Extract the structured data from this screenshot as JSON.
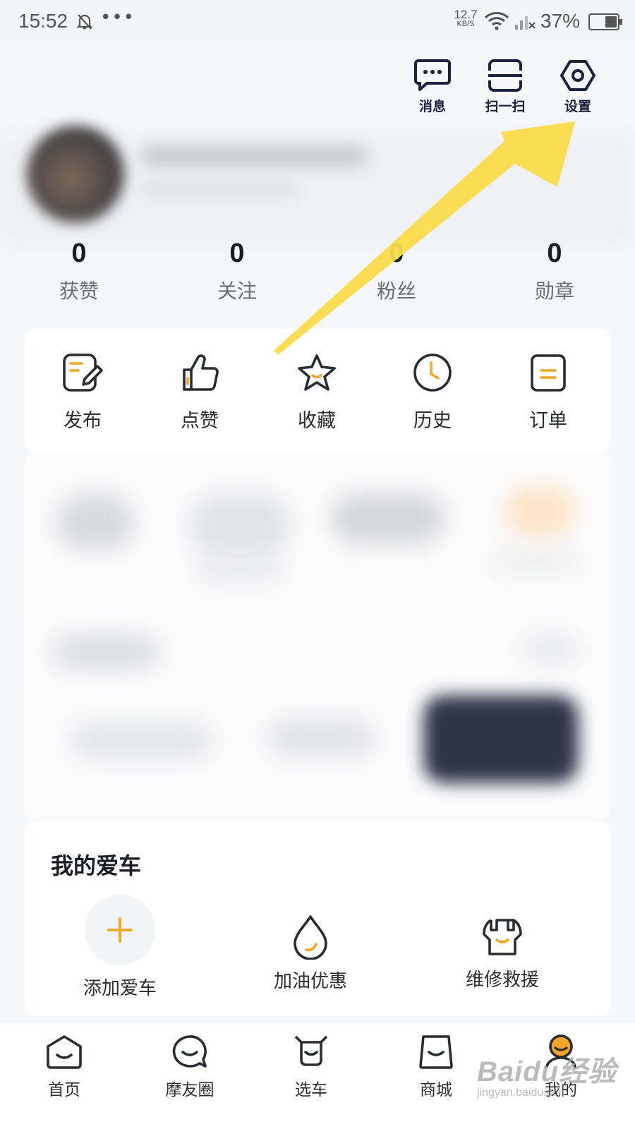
{
  "status_bar": {
    "time": "15:52",
    "dots": "•••",
    "net_speed_value": "12.7",
    "net_speed_unit": "KB/S",
    "battery": "37%"
  },
  "header": {
    "messages_label": "消息",
    "scan_label": "扫一扫",
    "settings_label": "设置"
  },
  "stats": [
    {
      "value": "0",
      "label": "获赞"
    },
    {
      "value": "0",
      "label": "关注"
    },
    {
      "value": "0",
      "label": "粉丝"
    },
    {
      "value": "0",
      "label": "勋章"
    }
  ],
  "quick_actions": [
    {
      "label": "发布",
      "icon": "edit-note-icon"
    },
    {
      "label": "点赞",
      "icon": "thumbs-up-icon"
    },
    {
      "label": "收藏",
      "icon": "star-icon"
    },
    {
      "label": "历史",
      "icon": "clock-icon"
    },
    {
      "label": "订单",
      "icon": "clipboard-icon"
    }
  ],
  "my_car": {
    "title": "我的爱车",
    "add_car": "添加爱车",
    "fuel_discount": "加油优惠",
    "repair_rescue": "维修救援"
  },
  "bottom_nav": [
    {
      "label": "首页",
      "icon": "home-icon"
    },
    {
      "label": "摩友圈",
      "icon": "chat-bubble-icon"
    },
    {
      "label": "选车",
      "icon": "motorbike-icon"
    },
    {
      "label": "商城",
      "icon": "shopping-bag-icon"
    },
    {
      "label": "我的",
      "icon": "profile-icon",
      "active": true
    }
  ],
  "watermark": {
    "line1": "Baidu经验",
    "line2": "jingyan.baidu.com"
  },
  "colors": {
    "accent": "#f4a62a",
    "annotation_arrow": "#fadb4a",
    "icon_stroke": "#2a2c33",
    "header_text": "#1a2240"
  }
}
